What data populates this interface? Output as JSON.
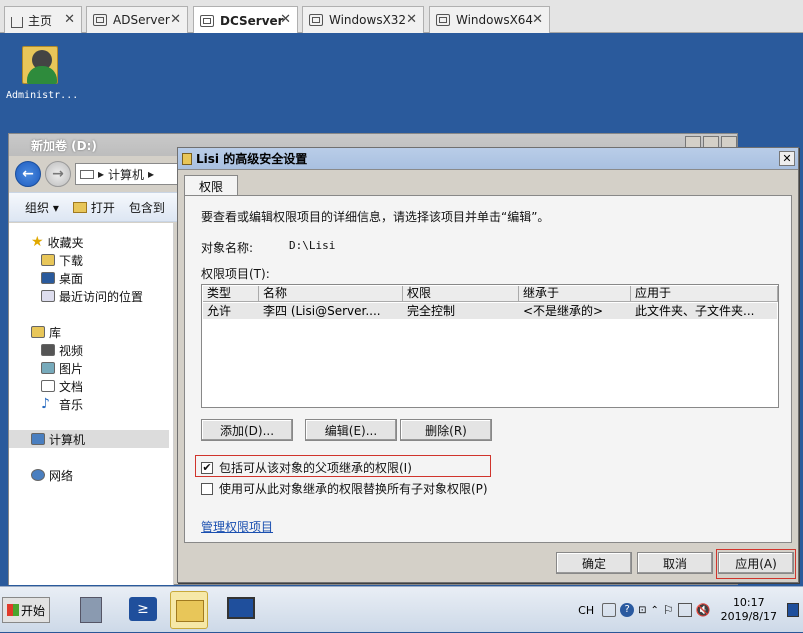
{
  "tabs": [
    {
      "label": "主页",
      "icon": "home-icon"
    },
    {
      "label": "ADServer",
      "icon": "vm-icon"
    },
    {
      "label": "DCServer",
      "icon": "vm-icon",
      "active": true
    },
    {
      "label": "WindowsX32",
      "icon": "vm-icon"
    },
    {
      "label": "WindowsX64",
      "icon": "vm-icon"
    }
  ],
  "desktop": {
    "icon_label": "Administr..."
  },
  "explorer": {
    "title": "新加卷 (D:)",
    "address": "计算机",
    "toolbar": {
      "organize": "组织",
      "open": "打开",
      "include": "包含到"
    },
    "sidebar": [
      {
        "label": "收藏夹",
        "icon": "star-icon"
      },
      {
        "label": "下载",
        "icon": "download-icon"
      },
      {
        "label": "桌面",
        "icon": "desktop-icon"
      },
      {
        "label": "最近访问的位置",
        "icon": "recent-icon"
      },
      {
        "label": "库",
        "icon": "library-icon"
      },
      {
        "label": "视频",
        "icon": "video-icon"
      },
      {
        "label": "图片",
        "icon": "picture-icon"
      },
      {
        "label": "文档",
        "icon": "document-icon"
      },
      {
        "label": "音乐",
        "icon": "music-icon"
      },
      {
        "label": "计算机",
        "icon": "computer-icon"
      },
      {
        "label": "网络",
        "icon": "network-icon"
      }
    ]
  },
  "dialog": {
    "title": "Lisi 的高级安全设置",
    "tab": "权限",
    "instruction": "要查看或编辑权限项目的详细信息，请选择该项目并单击“编辑”。",
    "object_label": "对象名称:",
    "object_value": "D:\\Lisi",
    "entries_label": "权限项目(T):",
    "columns": [
      "类型",
      "名称",
      "权限",
      "继承于",
      "应用于"
    ],
    "rows": [
      [
        "允许",
        "李四 (Lisi@Server....",
        "完全控制",
        "<不是继承的>",
        "此文件夹、子文件夹..."
      ]
    ],
    "buttons": {
      "add": "添加(D)...",
      "edit": "编辑(E)...",
      "delete": "删除(R)"
    },
    "checkbox_inherit": {
      "label": "包括可从该对象的父项继承的权限(I)",
      "checked": true
    },
    "checkbox_replace": {
      "label": "使用可从此对象继承的权限替换所有子对象权限(P)",
      "checked": false
    },
    "manage_link": "管理权限项目",
    "ok": "确定",
    "cancel": "取消",
    "apply": "应用(A)"
  },
  "taskbar": {
    "start": "开始",
    "lang": "CH",
    "time": "10:17",
    "date": "2019/8/17"
  }
}
